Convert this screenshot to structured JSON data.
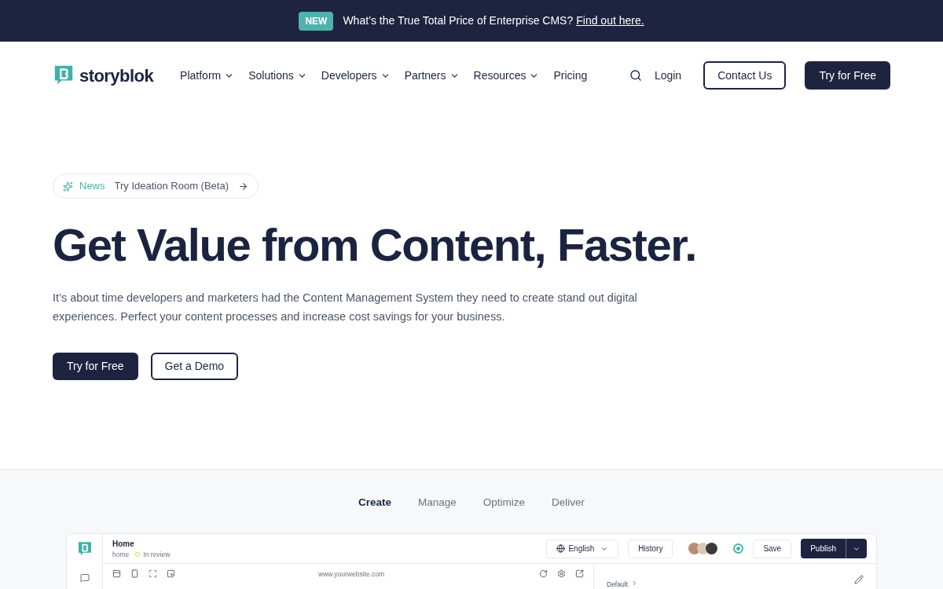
{
  "banner": {
    "badge": "NEW",
    "text": "What’s the True Total Price of Enterprise CMS?",
    "link": "Find out here."
  },
  "nav": {
    "logo": "storyblok",
    "items": [
      {
        "label": "Platform",
        "dropdown": true
      },
      {
        "label": "Solutions",
        "dropdown": true
      },
      {
        "label": "Developers",
        "dropdown": true
      },
      {
        "label": "Partners",
        "dropdown": true
      },
      {
        "label": "Resources",
        "dropdown": true
      },
      {
        "label": "Pricing",
        "dropdown": false
      }
    ],
    "login": "Login",
    "contact": "Contact Us",
    "try": "Try for Free"
  },
  "hero": {
    "news_label": "News",
    "news_text": "Try Ideation Room (Beta)",
    "title": "Get Value from Content, Faster.",
    "subtitle": "It’s about time developers and marketers had the Content Management System they need to create stand out digital experiences. Perfect your content processes and increase cost savings for your business.",
    "primary": "Try for Free",
    "secondary": "Get a Demo"
  },
  "tabs": [
    {
      "label": "Create",
      "selected": true
    },
    {
      "label": "Manage",
      "selected": false
    },
    {
      "label": "Optimize",
      "selected": false
    },
    {
      "label": "Deliver",
      "selected": false
    }
  ],
  "app": {
    "title": "Home",
    "slug": "home",
    "status": "In review",
    "language": "English",
    "history": "History",
    "save": "Save",
    "publish": "Publish",
    "url": "www.yourwebsite.com",
    "panel_label": "Default"
  }
}
